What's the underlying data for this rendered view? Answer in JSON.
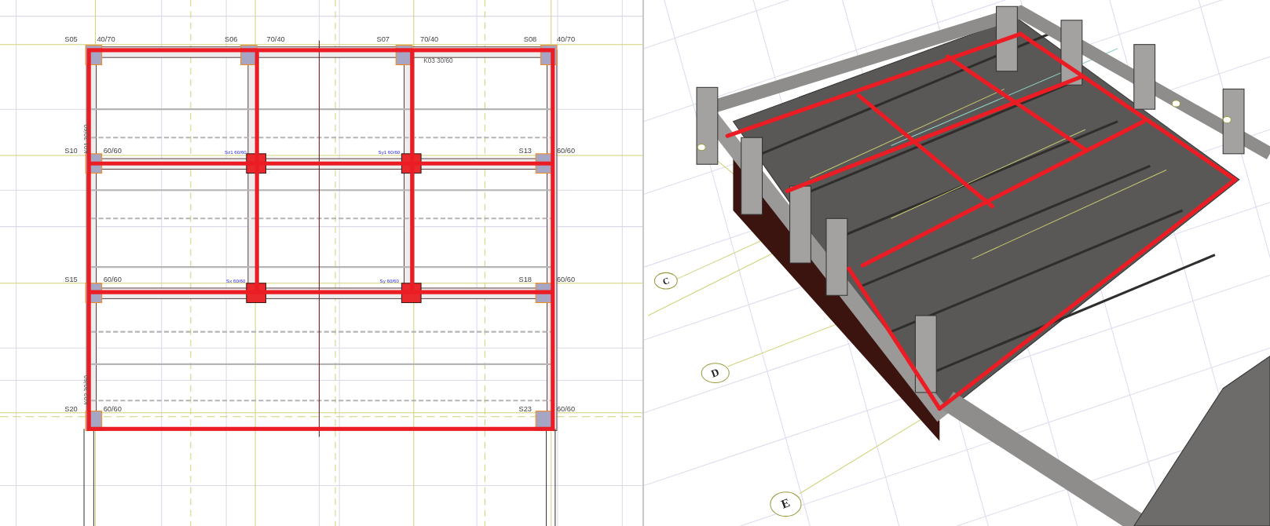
{
  "plan_view": {
    "column_labels": [
      "S05",
      "S06",
      "S07",
      "S08",
      "S10",
      "S13",
      "S15",
      "S18",
      "S20",
      "S23"
    ],
    "section_labels": [
      "40/70",
      "70/40",
      "70/40",
      "40/70",
      "60/60",
      "60/60",
      "60/60",
      "60/60",
      "60/60",
      "60/60"
    ],
    "beam_labels": [
      "K03 30/60",
      "K01 30/60",
      "K02 30/60"
    ],
    "column_tags": [
      "Sz1 60/60",
      "Sy1 60/60",
      "Sx 60/60",
      "Sy 60/60"
    ]
  },
  "view_3d": {
    "axis_bubbles": [
      "C",
      "D",
      "E"
    ]
  }
}
